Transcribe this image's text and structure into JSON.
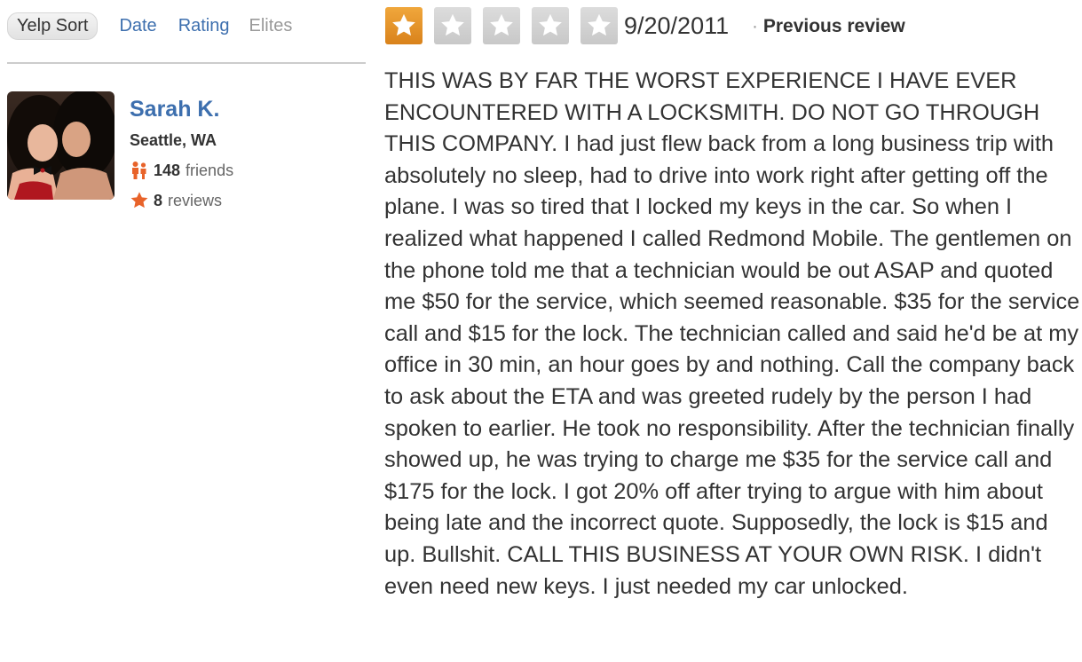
{
  "sort": {
    "active": "Yelp Sort",
    "date": "Date",
    "rating": "Rating",
    "elites": "Elites"
  },
  "user": {
    "name": "Sarah K.",
    "location": "Seattle, WA",
    "friends_count": "148",
    "friends_label": "friends",
    "reviews_count": "8",
    "reviews_label": "reviews",
    "friends_icon": "friends-icon",
    "reviews_icon": "star-icon"
  },
  "review": {
    "rating": 1,
    "max_rating": 5,
    "date": "9/20/2011",
    "separator": "·",
    "previous_review_label": "Previous review",
    "text": "THIS WAS BY FAR THE WORST EXPERIENCE I HAVE EVER ENCOUNTERED WITH A LOCKSMITH. DO NOT GO THROUGH THIS COMPANY. I had just flew back from a long business trip with absolutely no sleep, had to drive into work right after getting off the plane. I was so tired that I locked my keys in the car. So when I realized what happened I called Redmond Mobile. The gentlemen on the phone told me that a technician would be out ASAP and quoted me $50 for the service, which seemed reasonable. $35 for the service call and $15 for the lock. The technician called and said he'd be at my office in 30 min, an hour goes by and nothing. Call the company back to ask about the ETA and was greeted rudely by the person I had spoken to earlier. He took no responsibility. After the technician finally showed up, he was trying to charge me $35 for the service call and $175 for the lock. I got 20% off after trying to argue with him about being late and the incorrect quote. Supposedly, the lock is $15 and up. Bullshit. CALL THIS BUSINESS AT YOUR OWN RISK. I didn't even need new keys. I just needed my car unlocked."
  },
  "colors": {
    "link": "#3d6fae",
    "star_on": "#e8962b",
    "star_off": "#d0d0d0",
    "friends_icon": "#e8632a",
    "reviews_icon": "#e8632a"
  }
}
